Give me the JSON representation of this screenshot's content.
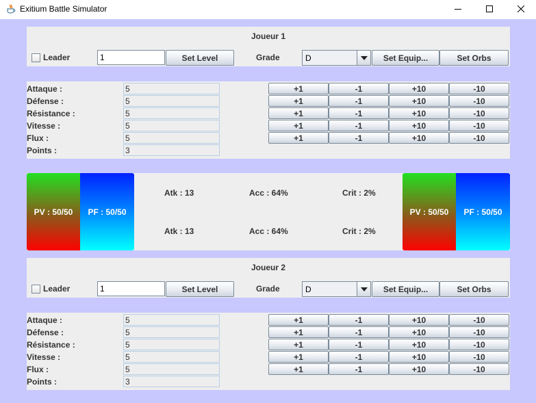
{
  "window": {
    "title": "Exitium Battle Simulator"
  },
  "players": [
    {
      "title": "Joueur 1",
      "leader_label": "Leader",
      "level_value": "1",
      "set_level_label": "Set Level",
      "grade_label": "Grade",
      "grade_value": "D",
      "set_equip_label": "Set Equip...",
      "set_orbs_label": "Set Orbs",
      "stats": [
        {
          "label": "Attaque :",
          "value": "5"
        },
        {
          "label": "Défense :",
          "value": "5"
        },
        {
          "label": "Résistance :",
          "value": "5"
        },
        {
          "label": "Vitesse :",
          "value": "5"
        },
        {
          "label": "Flux :",
          "value": "5"
        },
        {
          "label": "Points :",
          "value": "3"
        }
      ]
    },
    {
      "title": "Joueur 2",
      "leader_label": "Leader",
      "level_value": "1",
      "set_level_label": "Set Level",
      "grade_label": "Grade",
      "grade_value": "D",
      "set_equip_label": "Set Equip...",
      "set_orbs_label": "Set Orbs",
      "stats": [
        {
          "label": "Attaque :",
          "value": "5"
        },
        {
          "label": "Défense :",
          "value": "5"
        },
        {
          "label": "Résistance :",
          "value": "5"
        },
        {
          "label": "Vitesse :",
          "value": "5"
        },
        {
          "label": "Flux :",
          "value": "5"
        },
        {
          "label": "Points :",
          "value": "3"
        }
      ]
    }
  ],
  "stat_buttons": [
    "+1",
    "-1",
    "+10",
    "-10"
  ],
  "battle": {
    "p1": {
      "pv": "PV : 50/50",
      "pf": "PF : 50/50",
      "atk": "Atk : 13",
      "acc": "Acc : 64%",
      "crit": "Crit : 2%"
    },
    "p2": {
      "pv": "PV : 50/50",
      "pf": "PF : 50/50",
      "atk": "Atk : 13",
      "acc": "Acc : 64%",
      "crit": "Crit : 2%"
    }
  },
  "colors": {
    "background": "#c8c8ff",
    "panel": "#eeeeee",
    "pv_top": "#22e022",
    "pv_bottom": "#ff0000",
    "pf_top": "#0022ff",
    "pf_bottom": "#00ffff"
  }
}
